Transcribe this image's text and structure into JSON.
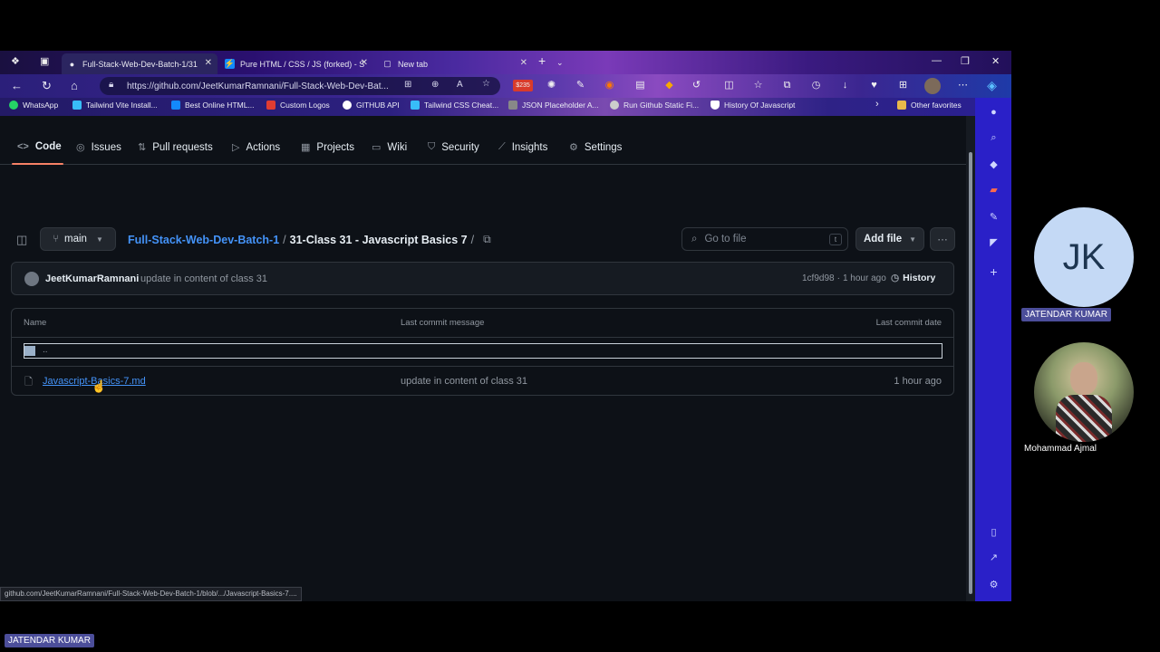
{
  "browser": {
    "tabs": [
      {
        "title": "Full-Stack-Web-Dev-Batch-1/31",
        "icon": "github-icon",
        "active": true
      },
      {
        "title": "Pure HTML / CSS / JS (forked) - S",
        "icon": "stackblitz-icon",
        "active": false
      },
      {
        "title": "New tab",
        "icon": "newtab-icon",
        "active": false
      }
    ],
    "url": "https://github.com/JeetKumarRamnani/Full-Stack-Web-Dev-Bat...",
    "extension_badge": "$235",
    "bookmarks": [
      {
        "label": "WhatsApp",
        "color": "#25d366"
      },
      {
        "label": "Tailwind Vite Install...",
        "color": "#38bdf8"
      },
      {
        "label": "Best Online HTML...",
        "color": "#1389fd"
      },
      {
        "label": "Custom Logos",
        "color": "#e03c31"
      },
      {
        "label": "GITHUB API",
        "color": "#ffffff"
      },
      {
        "label": "Tailwind CSS Cheat...",
        "color": "#38bdf8"
      },
      {
        "label": "JSON Placeholder A...",
        "color": "#888888"
      },
      {
        "label": "Run Github Static Fi...",
        "color": "#cccccc"
      },
      {
        "label": "History Of Javascript",
        "color": "#ffffff"
      }
    ],
    "other_favorites": "Other favorites",
    "status_url": "github.com/JeetKumarRamnani/Full-Stack-Web-Dev-Batch-1/blob/.../Javascript-Basics-7...."
  },
  "repo_nav": {
    "items": [
      "Code",
      "Issues",
      "Pull requests",
      "Actions",
      "Projects",
      "Wiki",
      "Security",
      "Insights",
      "Settings"
    ]
  },
  "crumbs": {
    "branch": "main",
    "repo": "Full-Stack-Web-Dev-Batch-1",
    "sep": "/",
    "folder": "31-Class 31 - Javascript Basics 7",
    "trailing_sep": "/",
    "goto_placeholder": "Go to file",
    "goto_shortcut": "t",
    "add_file": "Add file"
  },
  "commit": {
    "author": "JeetKumarRamnani",
    "message": "update in content of class 31",
    "sha": "1cf9d98",
    "dot": "·",
    "time": "1 hour ago",
    "history": "History"
  },
  "table": {
    "headers": {
      "name": "Name",
      "message": "Last commit message",
      "date": "Last commit date"
    },
    "parent": "..",
    "rows": [
      {
        "name": "Javascript-Basics-7.md",
        "message": "update in content of class 31",
        "date": "1 hour ago"
      }
    ]
  },
  "participants": [
    {
      "initials": "JK",
      "name": "JATENDAR KUMAR"
    },
    {
      "name": "Mohammad Ajmal"
    }
  ],
  "self_label": "JATENDAR KUMAR",
  "colors": {
    "accent": "#f78166",
    "link": "#4493f8",
    "avatar_bg": "#c4d9f5",
    "sidebar": "#2a20c8"
  }
}
